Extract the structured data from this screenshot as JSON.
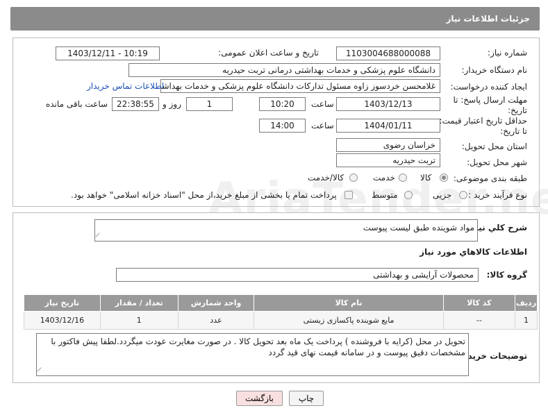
{
  "header": {
    "title": "جزئیات اطلاعات نیاز"
  },
  "labels": {
    "need_number": "شماره نیاز:",
    "announce_datetime": "تاریخ و ساعت اعلان عمومی:",
    "buyer_org": "نام دستگاه خریدار:",
    "requester": "ایجاد کننده درخواست:",
    "reply_deadline": "مهلت ارسال پاسخ: تا تاریخ:",
    "hour": "ساعت",
    "day_and": "روز و",
    "hours_remaining": "ساعت باقی مانده",
    "price_validity": "حداقل تاریخ اعتبار قیمت: تا تاریخ:",
    "delivery_province": "استان محل تحویل:",
    "delivery_city": "شهر محل تحویل:",
    "category": "طبقه بندی موضوعی:",
    "purchase_type": "نوع فرآیند خرید :",
    "general_desc": "شرح کلي نياز:",
    "goods_info": "اطلاعات کالاهاي مورد نياز",
    "goods_group": "گروه کالا:",
    "buyer_notes": "توضيحات خريدار:"
  },
  "values": {
    "need_number": "1103004688000088",
    "announce_datetime": "1403/12/11 - 10:19",
    "buyer_org": "دانشگاه علوم پزشکی و خدمات بهداشتی درمانی تربت حیدریه",
    "requester": "غلامحسن خردسوز زاوه مسئول تدارکات دانشگاه علوم پزشکی و خدمات بهداشت",
    "contact_link": "اطلاعات تماس خریدار",
    "reply_date": "1403/12/13",
    "reply_time": "10:20",
    "days": "1",
    "remaining": "22:38:55",
    "validity_date": "1404/01/11",
    "validity_time": "14:00",
    "province": "خراسان رضوی",
    "city": "تربت حیدریه",
    "general_desc": "مواد شوینده طبق لیست پیوست",
    "goods_group": "محصولات آرایشی و بهداشتی",
    "buyer_notes": "تحویل در محل (کرایه با فروشنده ) پرداخت یک ماه بعد تحویل کالا . در صورت مغایرت عودت میگردد.لطفا پیش فاکتور با مشخصات دقیق پیوست و در سامانه قیمت نهای قید گردد"
  },
  "category_options": [
    {
      "label": "کالا",
      "selected": true
    },
    {
      "label": "خدمت",
      "selected": false
    },
    {
      "label": "کالا/خدمت",
      "selected": false
    }
  ],
  "purchase_options": [
    {
      "label": "جزیی",
      "selected": false
    },
    {
      "label": "متوسط",
      "selected": false
    }
  ],
  "treasury_note": "پرداخت تمام یا بخشی از مبلغ خرید،از محل \"اسناد خزانه اسلامی\" خواهد بود.",
  "table": {
    "headers": [
      "ردیف",
      "کد کالا",
      "نام کالا",
      "واحد شمارش",
      "تعداد / مقدار",
      "تاریخ نیاز"
    ],
    "rows": [
      [
        "1",
        "--",
        "مایع شوینده پاکسازی زیستی",
        "عدد",
        "1",
        "1403/12/16"
      ]
    ]
  },
  "buttons": {
    "print": "چاپ",
    "back": "بازگشت"
  },
  "watermark": "AriaTender.neT",
  "colors": {
    "header_bg": "#8b8b8b",
    "table_header_bg": "#9a9a9a",
    "link": "#1a4fb5",
    "back_button_bg": "#f8e0e0"
  }
}
